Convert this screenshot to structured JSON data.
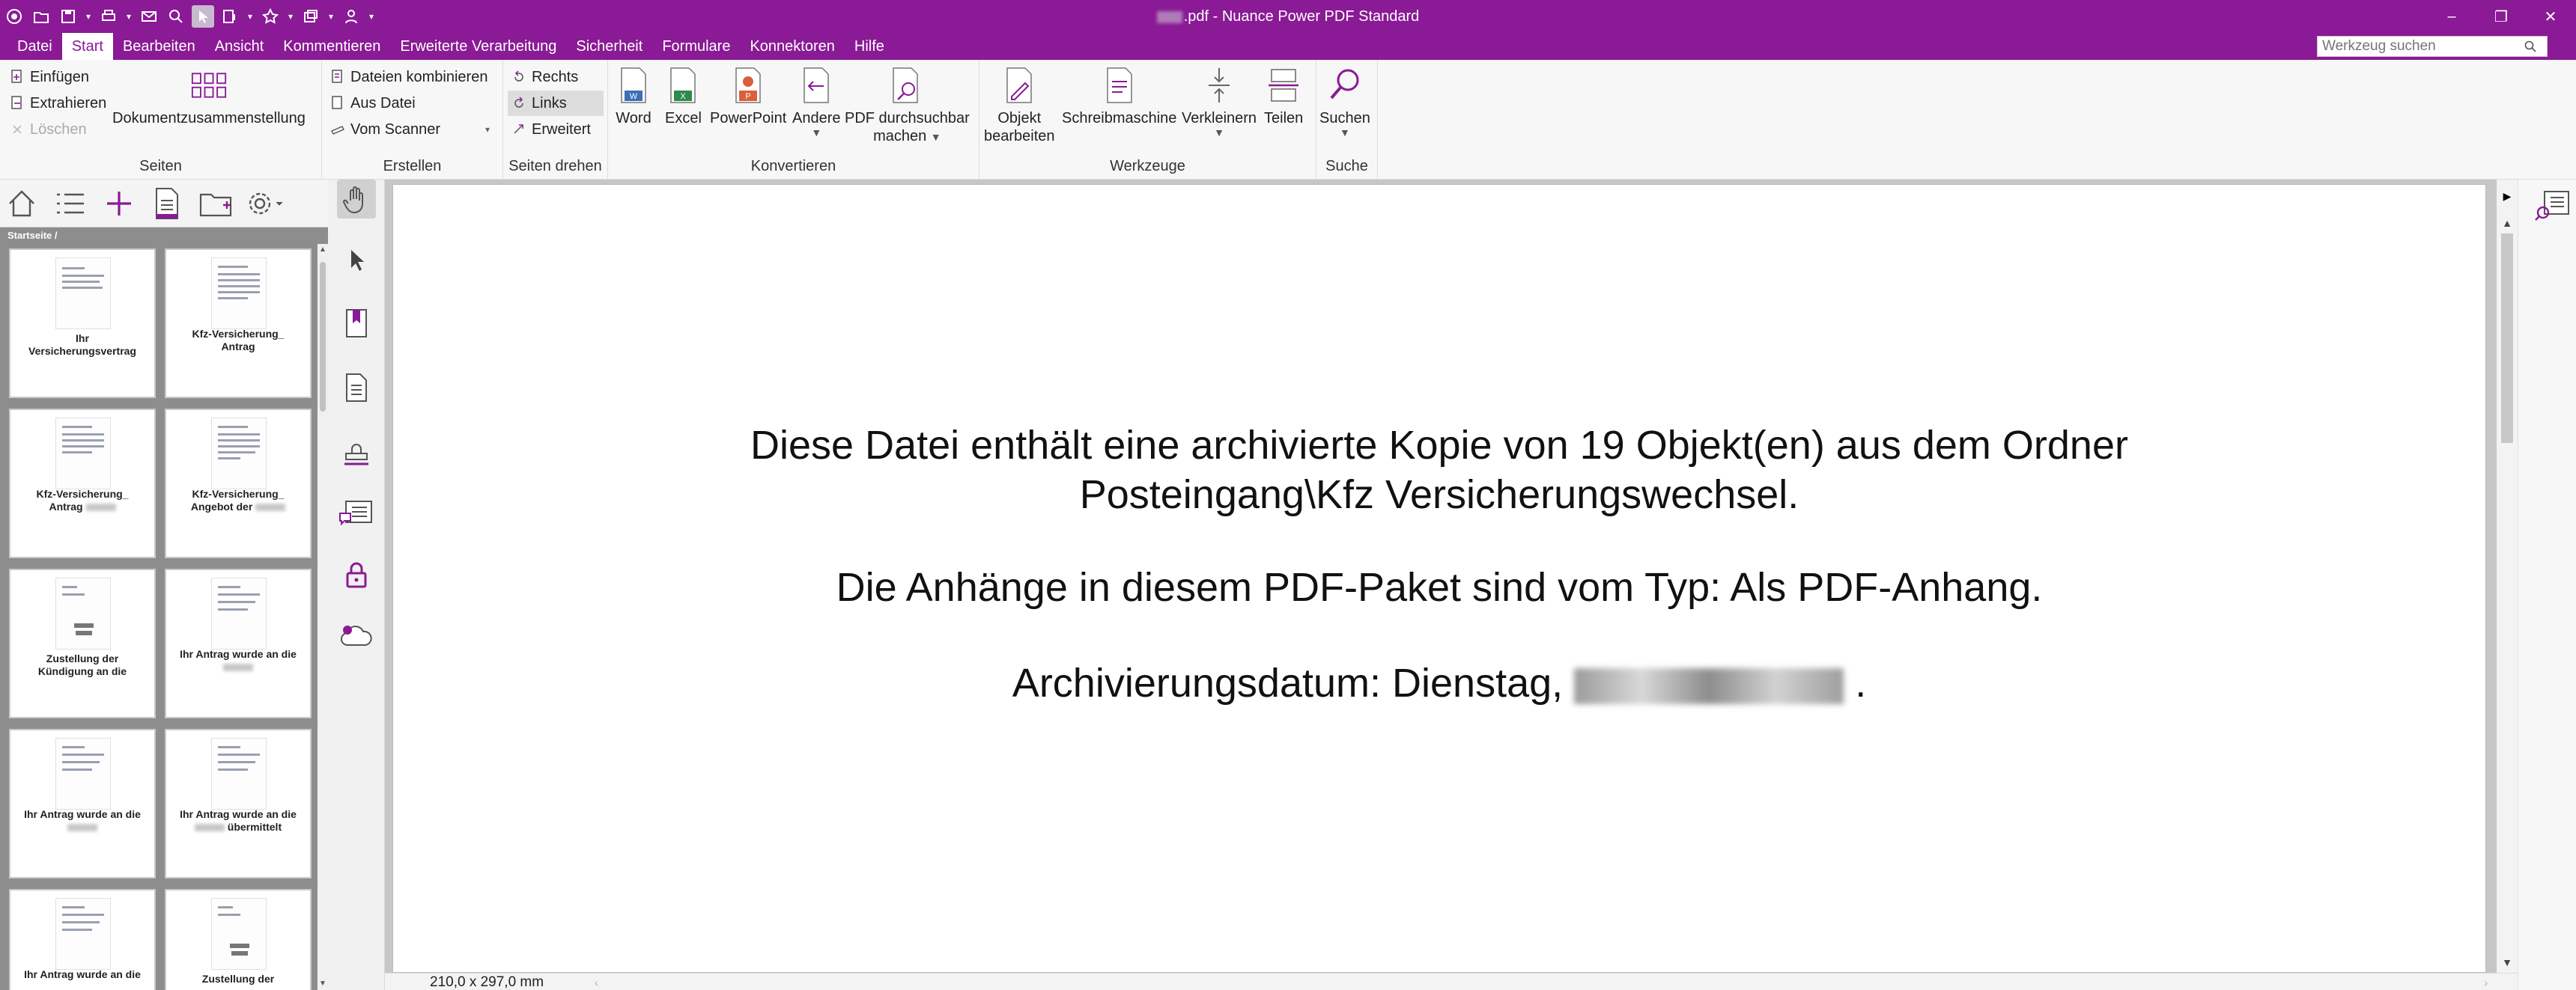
{
  "window": {
    "title_suffix": ".pdf - Nuance Power PDF Standard",
    "controls": [
      "–",
      "❐",
      "✕"
    ]
  },
  "menus": [
    "Datei",
    "Start",
    "Bearbeiten",
    "Ansicht",
    "Kommentieren",
    "Erweiterte Verarbeitung",
    "Sicherheit",
    "Formulare",
    "Konnektoren",
    "Hilfe"
  ],
  "active_menu": "Start",
  "tool_search": {
    "placeholder": "Werkzeug suchen"
  },
  "ribbon": {
    "seiten": {
      "label": "Seiten",
      "einfuegen": "Einfügen",
      "extrahieren": "Extrahieren",
      "loeschen": "Löschen",
      "dokument": "Dokumentzusammenstellung"
    },
    "erstellen": {
      "label": "Erstellen",
      "kombinieren": "Dateien kombinieren",
      "aus_datei": "Aus Datei",
      "vom_scanner": "Vom Scanner"
    },
    "drehen": {
      "label": "Seiten drehen",
      "rechts": "Rechts",
      "links": "Links",
      "erweitert": "Erweitert"
    },
    "konvertieren": {
      "label": "Konvertieren",
      "word": "Word",
      "excel": "Excel",
      "powerpoint": "PowerPoint",
      "andere": "Andere",
      "pdf_line1": "PDF durchsuchbar",
      "pdf_line2": "machen"
    },
    "werkzeuge": {
      "label": "Werkzeuge",
      "objekt_line1": "Objekt",
      "objekt_line2": "bearbeiten",
      "schreibmaschine": "Schreibmaschine",
      "verkleinern": "Verkleinern",
      "teilen": "Teilen"
    },
    "suche": {
      "label": "Suche",
      "suchen": "Suchen"
    }
  },
  "left_panel": {
    "breadcrumb": "Startseite /",
    "thumbnails": [
      {
        "line1": "Ihr",
        "line2": "Versicherungsvertrag"
      },
      {
        "line1": "Kfz-Versicherung_",
        "line2": "Antrag"
      },
      {
        "line1": "Kfz-Versicherung_",
        "line2": "Antrag"
      },
      {
        "line1": "Kfz-Versicherung_",
        "line2": "Angebot der"
      },
      {
        "line1": "Zustellung der",
        "line2": "Kündigung an die"
      },
      {
        "line1": "Ihr Antrag wurde an die",
        "line2": ""
      },
      {
        "line1": "Ihr Antrag wurde an die",
        "line2": ""
      },
      {
        "line1": "Ihr Antrag wurde an die",
        "line2": "übermittelt"
      },
      {
        "line1": "Ihr Antrag wurde an die",
        "line2": ""
      },
      {
        "line1": "Zustellung der",
        "line2": ""
      }
    ]
  },
  "document": {
    "line1": "Diese Datei enthält eine archivierte Kopie von 19 Objekt(en) aus dem Ordner",
    "line2": "Posteingang\\Kfz Versicherungswechsel.",
    "line3": "Die Anhänge in diesem PDF-Paket sind vom Typ: Als PDF-Anhang.",
    "line4_prefix": "Archivierungsdatum: Dienstag,",
    "line4_suffix": "."
  },
  "status": {
    "dimensions": "210,0 x 297,0 mm"
  },
  "colors": {
    "accent": "#8a1a95",
    "ribbon_bg": "#f7f7f7",
    "panel_bg": "#8d8d8d"
  }
}
